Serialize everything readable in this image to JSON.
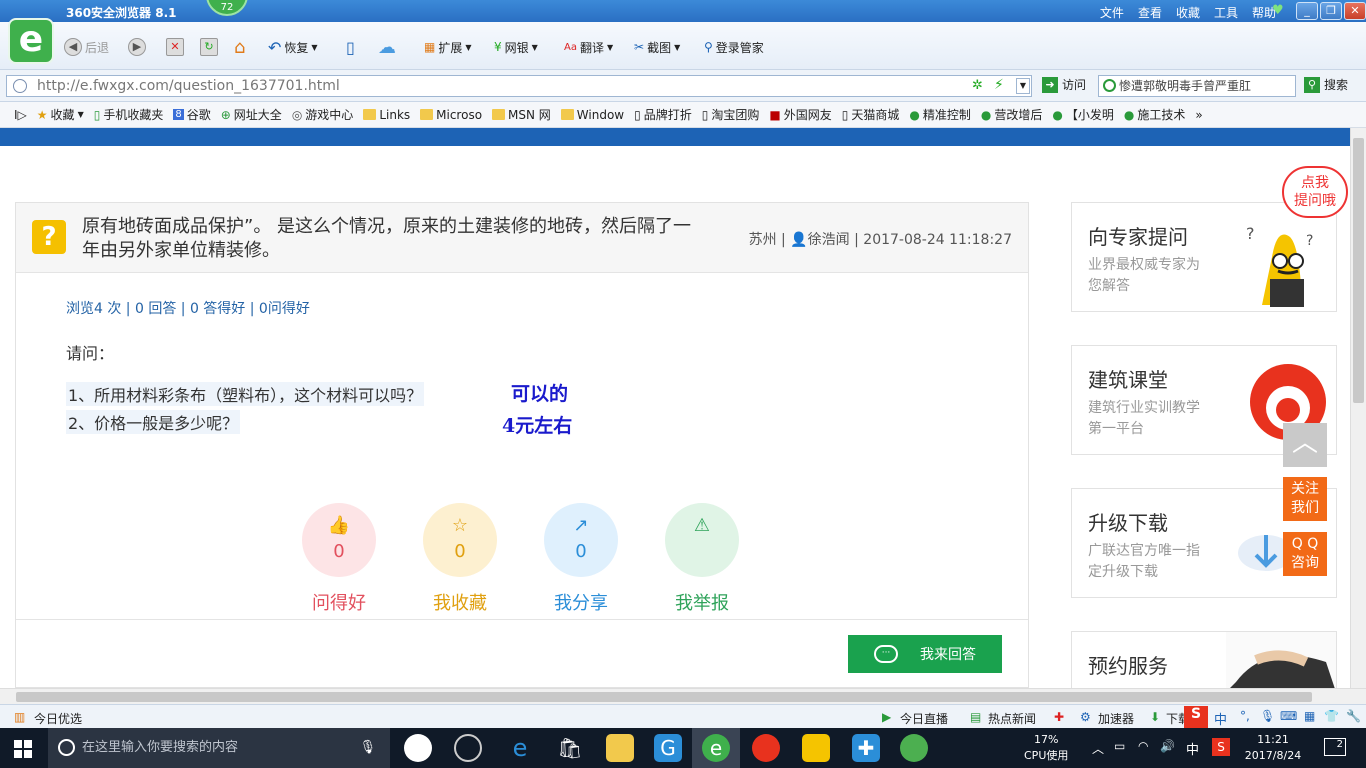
{
  "browser": {
    "title": "360安全浏览器 8.1",
    "badge": "72",
    "menu": [
      "文件",
      "查看",
      "收藏",
      "工具",
      "帮助"
    ],
    "toolbar": {
      "back": "后退",
      "restore": "恢复",
      "extend": "扩展",
      "bank": "网银",
      "translate": "翻译",
      "screenshot": "截图",
      "login": "登录管家"
    },
    "url": "http://e.fwxgx.com/question_1637701.html",
    "go_label": "访问",
    "search_value": "惨遭郭敬明毒手曾严重肛",
    "search_label": "搜索",
    "bookmarks": [
      "收藏",
      "手机收藏夹",
      "谷歌",
      "网址大全",
      "游戏中心",
      "Links",
      "Microso",
      "MSN 网",
      "Window",
      "品牌打折",
      "淘宝团购",
      "外国网友",
      "天猫商城",
      "精准控制",
      "营改增后",
      "【小发明",
      "施工技术"
    ]
  },
  "question": {
    "title": "原有地砖面成品保护”。 是这么个情况，原来的土建装修的地砖，然后隔了一年由另外家单位精装修。",
    "location": "苏州",
    "user": "徐浩闻",
    "datetime": "2017-08-24 11:18:27",
    "stats": "浏览4 次 | 0 回答 | 0 答得好 | 0问得好",
    "ask_label": "请问：",
    "lines": [
      "1、所用材料彩条布（塑料布），这个材料可以吗？",
      "2、价格一般是多少呢？"
    ],
    "annotations": [
      "可以的",
      "4元左右"
    ]
  },
  "actions": [
    {
      "label": "问得好",
      "count": "0",
      "icon": "thumbs-up-icon",
      "color": "#e2505e",
      "bg": "#fde4e6"
    },
    {
      "label": "我收藏",
      "count": "0",
      "icon": "star-icon",
      "color": "#e0a010",
      "bg": "#fdf0d0"
    },
    {
      "label": "我分享",
      "count": "0",
      "icon": "share-icon",
      "color": "#2b8ed8",
      "bg": "#dff0fd"
    },
    {
      "label": "我举报",
      "count": "0",
      "icon": "warning-icon",
      "color": "#2fa35a",
      "bg": "#e0f4e6"
    }
  ],
  "answer_button": "我来回答",
  "sidebar": {
    "bubble": [
      "点我",
      "提问哦"
    ],
    "cards": [
      {
        "title": "向专家提问",
        "sub": "业界最权威专家为您解答"
      },
      {
        "title": "建筑课堂",
        "sub": "建筑行业实训教学第一平台"
      },
      {
        "title": "升级下载",
        "sub": "广联达官方唯一指定升级下载"
      },
      {
        "title": "预约服务",
        "sub": ""
      }
    ],
    "follow": [
      "关注",
      "我们"
    ],
    "qq": [
      "Q Q",
      "咨询"
    ]
  },
  "statusbar": {
    "left": "今日优选",
    "items": [
      "今日直播",
      "热点新闻",
      "加速器",
      "下载"
    ],
    "ime": "中"
  },
  "taskbar": {
    "search_placeholder": "在这里输入你要搜索的内容",
    "cpu": "17%",
    "cpu_label": "CPU使用",
    "ime": "中",
    "time": "11:21",
    "date": "2017/8/24",
    "notifications": "2"
  }
}
